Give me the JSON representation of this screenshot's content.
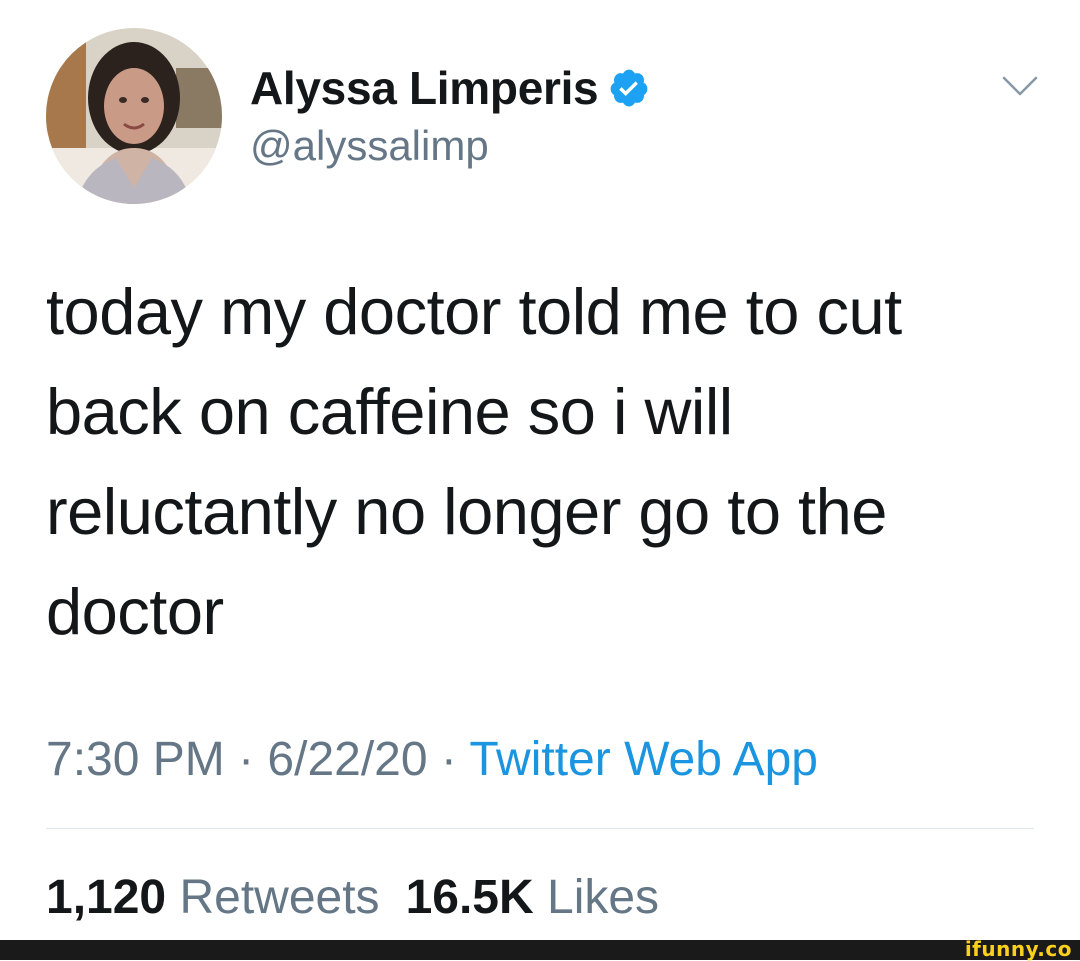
{
  "tweet": {
    "display_name": "Alyssa Limperis",
    "handle": "@alyssalimp",
    "verified": true,
    "text": "today my doctor told me to cut\nback on caffeine so i will\nreluctantly no longer go to the\ndoctor",
    "time": "7:30 PM",
    "separator": " · ",
    "date": "6/22/20",
    "source": "Twitter Web App",
    "retweets": {
      "count": "1,120",
      "label": "Retweets"
    },
    "likes": {
      "count": "16.5K",
      "label": "Likes"
    }
  },
  "icons": {
    "verified": "verified-badge-icon",
    "menu": "chevron-down-icon"
  },
  "colors": {
    "text_primary": "#14171a",
    "text_secondary": "#657786",
    "link": "#1b95e0",
    "verified": "#1da1f2",
    "divider": "#e1e8ed",
    "watermark": "#f9d01b"
  },
  "watermark": {
    "text": "ifunny.co"
  }
}
